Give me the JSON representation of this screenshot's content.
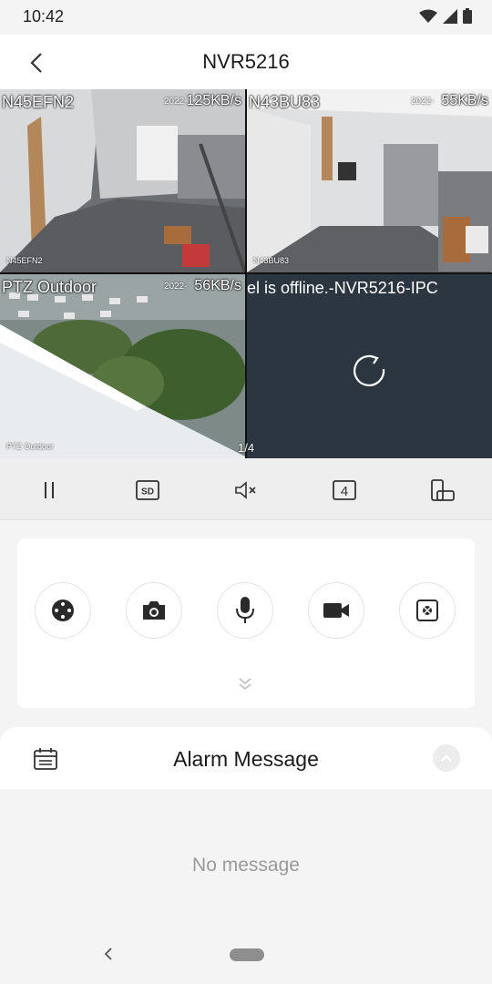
{
  "status_bar": {
    "time": "10:42"
  },
  "header": {
    "title": "NVR5216"
  },
  "cameras": [
    {
      "label": "N45EFN2",
      "rate": "125KB/s",
      "stamp": "2022-",
      "osd": "N45EFN2"
    },
    {
      "label": "N43BU83",
      "rate": "55KB/s",
      "stamp": "2022-",
      "osd": "N43BU83"
    },
    {
      "label": "PTZ Outdoor",
      "rate": "56KB/s",
      "stamp": "2022-",
      "osd": "PTZ Outdoor"
    },
    {
      "offline_text": "el is offline.-NVR5216-IPC"
    }
  ],
  "page_indicator": "1/4",
  "controls": {
    "split_count": "4",
    "quality_label": "SD"
  },
  "alarm": {
    "title": "Alarm Message",
    "empty_text": "No message"
  },
  "icons": [
    "back-icon",
    "pause-icon",
    "sd-icon",
    "mute-icon",
    "split-screen-icon",
    "rotate-icon",
    "ptz-icon",
    "snapshot-icon",
    "microphone-icon",
    "record-icon",
    "fisheye-icon",
    "chevron-down-double-icon",
    "calendar-icon",
    "chevron-up-icon",
    "reload-icon"
  ],
  "colors": {
    "offline_bg": "#2b3640",
    "header_bg": "#ffffff",
    "page_bg": "#f4f4f4"
  }
}
